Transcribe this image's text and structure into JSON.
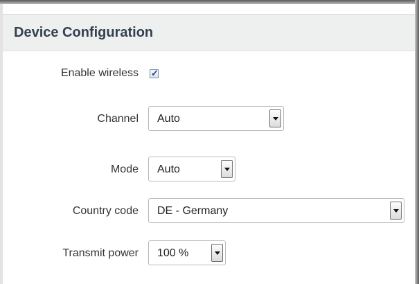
{
  "section": {
    "title": "Device Configuration"
  },
  "fields": {
    "enable_wireless": {
      "label": "Enable wireless",
      "checked": true
    },
    "channel": {
      "label": "Channel",
      "value": "Auto"
    },
    "mode": {
      "label": "Mode",
      "value": "Auto"
    },
    "country_code": {
      "label": "Country code",
      "value": "DE - Germany"
    },
    "transmit_power": {
      "label": "Transmit power",
      "value": "100 %"
    }
  },
  "colors": {
    "header_bg": "#eef0f0",
    "header_text": "#33414e",
    "checkmark": "#2a3f9a"
  },
  "icons": {
    "dropdown": "chevron-down-icon",
    "check": "checkmark-icon"
  }
}
